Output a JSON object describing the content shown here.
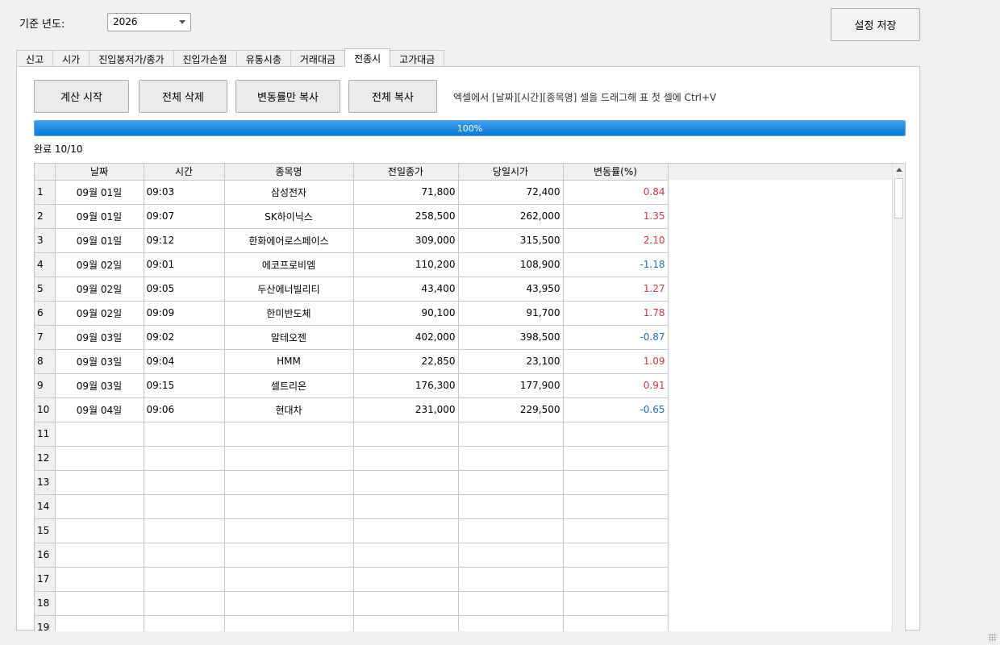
{
  "top": {
    "year_label": "기준 년도:",
    "year_value": "2026",
    "save_label": "설정 저장"
  },
  "tabs": [
    "신고",
    "시가",
    "진입봉저가/종가",
    "진입가손절",
    "유통시총",
    "거래대금",
    "전종시",
    "고가대금"
  ],
  "active_tab": 6,
  "actions": {
    "start": "계산 시작",
    "clear": "전체 삭제",
    "copy_rate": "변동률만 복사",
    "copy_all": "전체 복사",
    "hint": "엑셀에서 [날짜][시간][종목명] 셀을 드래그해 표 첫 셀에 Ctrl+V"
  },
  "progress": {
    "value": 1.0,
    "text": "100%"
  },
  "status": "완료 10/10",
  "columns": [
    "날짜",
    "시간",
    "종목명",
    "전일종가",
    "당일시가",
    "변동률(%)"
  ],
  "rows": [
    {
      "num": "1",
      "date": "09월 01일",
      "time": "09:03",
      "name": "삼성전자",
      "prev": "71,800",
      "open": "72,400",
      "rate": "0.84",
      "dir": "pos"
    },
    {
      "num": "2",
      "date": "09월 01일",
      "time": "09:07",
      "name": "SK하이닉스",
      "prev": "258,500",
      "open": "262,000",
      "rate": "1.35",
      "dir": "pos"
    },
    {
      "num": "3",
      "date": "09월 01일",
      "time": "09:12",
      "name": "한화에어로스페이스",
      "prev": "309,000",
      "open": "315,500",
      "rate": "2.10",
      "dir": "pos"
    },
    {
      "num": "4",
      "date": "09월 02일",
      "time": "09:01",
      "name": "에코프로비엠",
      "prev": "110,200",
      "open": "108,900",
      "rate": "-1.18",
      "dir": "neg"
    },
    {
      "num": "5",
      "date": "09월 02일",
      "time": "09:05",
      "name": "두산에너빌리티",
      "prev": "43,400",
      "open": "43,950",
      "rate": "1.27",
      "dir": "pos"
    },
    {
      "num": "6",
      "date": "09월 02일",
      "time": "09:09",
      "name": "한미반도체",
      "prev": "90,100",
      "open": "91,700",
      "rate": "1.78",
      "dir": "pos"
    },
    {
      "num": "7",
      "date": "09월 03일",
      "time": "09:02",
      "name": "알테오젠",
      "prev": "402,000",
      "open": "398,500",
      "rate": "-0.87",
      "dir": "neg"
    },
    {
      "num": "8",
      "date": "09월 03일",
      "time": "09:04",
      "name": "HMM",
      "prev": "22,850",
      "open": "23,100",
      "rate": "1.09",
      "dir": "pos"
    },
    {
      "num": "9",
      "date": "09월 03일",
      "time": "09:15",
      "name": "셀트리온",
      "prev": "176,300",
      "open": "177,900",
      "rate": "0.91",
      "dir": "pos"
    },
    {
      "num": "10",
      "date": "09월 04일",
      "time": "09:06",
      "name": "현대차",
      "prev": "231,000",
      "open": "229,500",
      "rate": "-0.65",
      "dir": "neg"
    }
  ],
  "empty_rows": [
    "11",
    "12",
    "13",
    "14",
    "15",
    "16",
    "17",
    "18",
    "19"
  ],
  "colors": {
    "positive": "#d9363e",
    "negative": "#1f6fbf",
    "progress": "#0a78d7"
  }
}
